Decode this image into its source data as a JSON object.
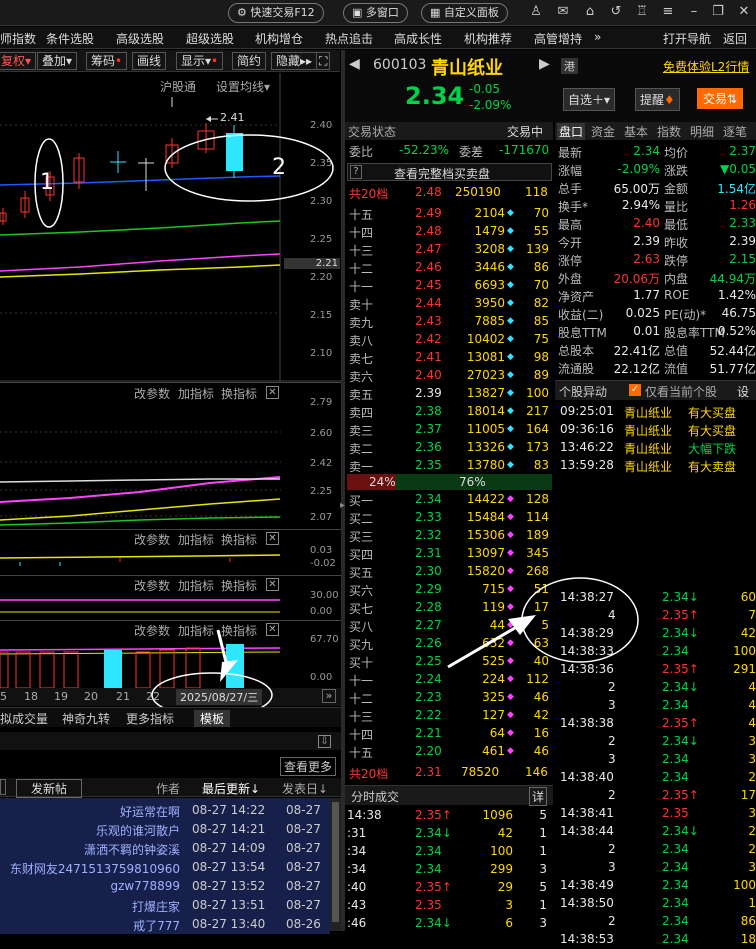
{
  "topbar": {
    "quick_trade": "快速交易F12",
    "multi_window": "多窗口",
    "custom_panel": "自定义面板"
  },
  "nav": [
    "师指数",
    "条件选股",
    "高级选股",
    "超级选股",
    "机构增仓",
    "热点追击",
    "高成长性",
    "机构推荐",
    "高管增持",
    "»",
    "打开导航",
    "返回"
  ],
  "chart_toolbar": [
    "复权",
    "叠加",
    "筹码",
    "画线",
    "显示",
    "简约",
    "隐藏"
  ],
  "chart_header": {
    "exchange": "沪股通",
    "ma_setting": "设置均线",
    "annot_241": "2.41"
  },
  "price_axis": [
    "2.40",
    "2.35",
    "2.30",
    "2.25",
    "2.21",
    "2.20",
    "2.15",
    "2.10",
    "2.05"
  ],
  "panels": [
    {
      "buttons": [
        "改参数",
        "加指标",
        "换指标"
      ],
      "axis": [
        "2.79",
        "2.60",
        "2.42",
        "2.25",
        "2.07"
      ]
    },
    {
      "buttons": [
        "改参数",
        "加指标",
        "换指标"
      ],
      "axis": [
        "0.03",
        "-0.02"
      ]
    },
    {
      "buttons": [
        "改参数",
        "加指标",
        "换指标"
      ],
      "axis": [
        "30.00",
        "0.00"
      ]
    },
    {
      "buttons": [
        "改参数",
        "加指标",
        "换指标"
      ],
      "axis": [
        "67.70",
        "0.00"
      ]
    }
  ],
  "x_dates": [
    "5",
    "18",
    "19",
    "20",
    "21",
    "22"
  ],
  "cursor_date": "2025/08/27/三",
  "bottom_tabs": [
    "拟成交量",
    "神奇九转",
    "更多指标",
    "模板"
  ],
  "forum": {
    "post_button": "发新帖",
    "more": "查看更多",
    "col_author": "作者",
    "col_updated": "最后更新",
    "col_posted": "发表日",
    "rows": [
      [
        "好运常在啊",
        "08-27 14:22",
        "08-27"
      ],
      [
        "乐观的谁河散户",
        "08-27 14:21",
        "08-27"
      ],
      [
        "潇洒不羁的钟姿溪",
        "08-27 14:09",
        "08-27"
      ],
      [
        "东财网友2471513759810960",
        "08-27 13:54",
        "08-27"
      ],
      [
        "gzw778899",
        "08-27 13:52",
        "08-27"
      ],
      [
        "打爆庄家",
        "08-27 13:51",
        "08-27"
      ],
      [
        "戒了777",
        "08-27 13:40",
        "08-26"
      ]
    ]
  },
  "stock": {
    "code": "600103",
    "name": "青山纸业",
    "market": "港",
    "price": "2.34",
    "change": "-0.05",
    "change_pct": "-2.09%",
    "l2": "免费体验L2行情",
    "btn_watch": "自选",
    "btn_alert": "提醒",
    "btn_trade": "交易"
  },
  "ob": {
    "tab_status": "交易状态",
    "tab_trading": "交易中",
    "webi_label": "委比",
    "webi": "-52.23%",
    "weicha_label": "委差",
    "weicha": "-171670",
    "full_order": "查看完整档买卖盘",
    "total_sell": {
      "label": "共20档",
      "price": "2.48",
      "vol": "250190",
      "n": "118"
    },
    "sells": [
      [
        "十五",
        "2.49",
        "2104",
        "70"
      ],
      [
        "十四",
        "2.48",
        "1479",
        "55"
      ],
      [
        "十三",
        "2.47",
        "3208",
        "139"
      ],
      [
        "十二",
        "2.46",
        "3446",
        "86"
      ],
      [
        "十一",
        "2.45",
        "6693",
        "70"
      ],
      [
        "卖十",
        "2.44",
        "3950",
        "82"
      ],
      [
        "卖九",
        "2.43",
        "7885",
        "85"
      ],
      [
        "卖八",
        "2.42",
        "10402",
        "75"
      ],
      [
        "卖七",
        "2.41",
        "13081",
        "98"
      ],
      [
        "卖六",
        "2.40",
        "27023",
        "89"
      ],
      [
        "卖五",
        "2.39",
        "13827",
        "100"
      ],
      [
        "卖四",
        "2.38",
        "18014",
        "217"
      ],
      [
        "卖三",
        "2.37",
        "11005",
        "164"
      ],
      [
        "卖二",
        "2.36",
        "13326",
        "173"
      ],
      [
        "卖一",
        "2.35",
        "13780",
        "83"
      ]
    ],
    "ratio_sell": "24%",
    "ratio_buy": "76%",
    "buys": [
      [
        "买一",
        "2.34",
        "14422",
        "128"
      ],
      [
        "买二",
        "2.33",
        "15484",
        "114"
      ],
      [
        "买三",
        "2.32",
        "15306",
        "189"
      ],
      [
        "买四",
        "2.31",
        "13097",
        "345"
      ],
      [
        "买五",
        "2.30",
        "15820",
        "268"
      ],
      [
        "买六",
        "2.29",
        "715",
        "51"
      ],
      [
        "买七",
        "2.28",
        "119",
        "17"
      ],
      [
        "买八",
        "2.27",
        "44",
        "5"
      ],
      [
        "买九",
        "2.26",
        "632",
        "63"
      ],
      [
        "买十",
        "2.25",
        "525",
        "40"
      ],
      [
        "十一",
        "2.24",
        "224",
        "112"
      ],
      [
        "十二",
        "2.23",
        "325",
        "46"
      ],
      [
        "十三",
        "2.22",
        "127",
        "42"
      ],
      [
        "十四",
        "2.21",
        "64",
        "16"
      ],
      [
        "十五",
        "2.20",
        "461",
        "46"
      ]
    ],
    "total_buy": {
      "label": "共20档",
      "price": "2.31",
      "vol": "78520",
      "n": "146"
    }
  },
  "ticks_left": {
    "title": "分时成交",
    "detail": "详",
    "rows": [
      [
        "14:38",
        "2.35",
        "↑",
        "1096",
        "5"
      ],
      [
        ":31",
        "2.34",
        "↓",
        "42",
        "1"
      ],
      [
        ":34",
        "2.34",
        "",
        "100",
        "1"
      ],
      [
        ":34",
        "2.34",
        "",
        "299",
        "3"
      ],
      [
        ":40",
        "2.35",
        "↑",
        "29",
        "5"
      ],
      [
        ":43",
        "2.35",
        "",
        "3",
        "1"
      ],
      [
        ":46",
        "2.34",
        "↓",
        "6",
        "3"
      ]
    ]
  },
  "info_tabs": [
    "盘口",
    "资金",
    "基本",
    "指数",
    "明细",
    "逐笔"
  ],
  "info": [
    [
      "最新",
      "2.34",
      "均价",
      "2.37"
    ],
    [
      "涨幅",
      "-2.09%",
      "涨跌",
      "▼0.05"
    ],
    [
      "总手",
      "65.00万",
      "金额",
      "1.54亿"
    ],
    [
      "换手*",
      "2.94%",
      "量比",
      "1.26"
    ],
    [
      "最高",
      "2.40",
      "最低",
      "2.33"
    ],
    [
      "今开",
      "2.39",
      "昨收",
      "2.39"
    ],
    [
      "涨停",
      "2.63",
      "跌停",
      "2.15"
    ],
    [
      "外盘",
      "20.06万",
      "内盘",
      "44.94万"
    ],
    [
      "净资产",
      "1.77",
      "ROE",
      "1.42%"
    ],
    [
      "收益(二)",
      "0.025",
      "PE(动)*",
      "46.75"
    ],
    [
      "股息TTM",
      "0.01",
      "股息率TTM",
      "0.52%"
    ],
    [
      "总股本",
      "22.41亿",
      "总值",
      "52.44亿"
    ],
    [
      "流通股",
      "22.12亿",
      "流值",
      "51.77亿"
    ]
  ],
  "alerts": {
    "title": "个股异动",
    "checkbox": "仅看当前个股",
    "settings": "设",
    "rows": [
      [
        "09:25:01",
        "青山纸业",
        "有大买盘"
      ],
      [
        "09:36:16",
        "青山纸业",
        "有大买盘"
      ],
      [
        "13:46:22",
        "青山纸业",
        "大幅下跌"
      ],
      [
        "13:59:28",
        "青山纸业",
        "有大卖盘"
      ]
    ]
  },
  "ticks_right": [
    [
      "14:38:27",
      "2.34",
      "↓",
      "60"
    ],
    [
      "4",
      "2.35",
      "↑",
      "7"
    ],
    [
      "14:38:29",
      "2.34",
      "↓",
      "42"
    ],
    [
      "14:38:33",
      "2.34",
      "",
      "100"
    ],
    [
      "14:38:36",
      "2.35",
      "↑",
      "291"
    ],
    [
      "2",
      "2.34",
      "↓",
      "4"
    ],
    [
      "3",
      "2.34",
      "",
      "4"
    ],
    [
      "14:38:38",
      "2.35",
      "↑",
      "4"
    ],
    [
      "2",
      "2.34",
      "↓",
      "3"
    ],
    [
      "3",
      "2.34",
      "",
      "3"
    ],
    [
      "14:38:40",
      "2.34",
      "",
      "2"
    ],
    [
      "2",
      "2.35",
      "↑",
      "17"
    ],
    [
      "14:38:41",
      "2.35",
      "",
      "3"
    ],
    [
      "14:38:44",
      "2.34",
      "↓",
      "2"
    ],
    [
      "2",
      "2.34",
      "",
      "2"
    ],
    [
      "3",
      "2.34",
      "",
      "3"
    ],
    [
      "14:38:49",
      "2.34",
      "",
      "100"
    ],
    [
      "14:38:50",
      "2.34",
      "",
      "1"
    ],
    [
      "2",
      "2.34",
      "",
      "86"
    ],
    [
      "14:38:53",
      "2.34",
      "",
      "18"
    ]
  ],
  "annotations": {
    "circle1": "1",
    "circle2": "2"
  }
}
